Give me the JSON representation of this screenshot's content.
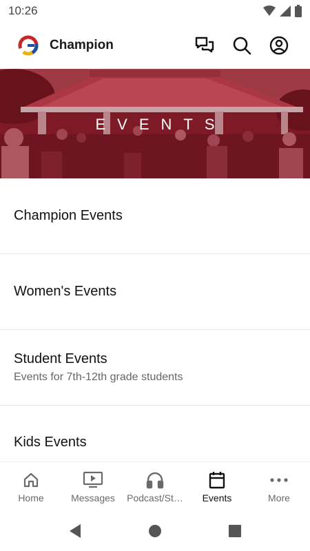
{
  "status_bar": {
    "time": "10:26"
  },
  "app_bar": {
    "title": "Champion"
  },
  "banner": {
    "title": "EVENTS"
  },
  "events": [
    {
      "title": "Champion Events",
      "subtitle": ""
    },
    {
      "title": "Women's Events",
      "subtitle": ""
    },
    {
      "title": "Student Events",
      "subtitle": "Events for 7th-12th grade students"
    },
    {
      "title": "Kids Events",
      "subtitle": ""
    }
  ],
  "bottom_nav": [
    {
      "label": "Home",
      "icon": "home-icon"
    },
    {
      "label": "Messages",
      "icon": "tv-play-icon"
    },
    {
      "label": "Podcast/St…",
      "icon": "headphones-icon"
    },
    {
      "label": "Events",
      "icon": "calendar-icon",
      "active": true
    },
    {
      "label": "More",
      "icon": "more-dots-icon"
    }
  ],
  "colors": {
    "banner_tint": "#8c1c28",
    "active": "#111111",
    "inactive": "#6a6a6a"
  }
}
